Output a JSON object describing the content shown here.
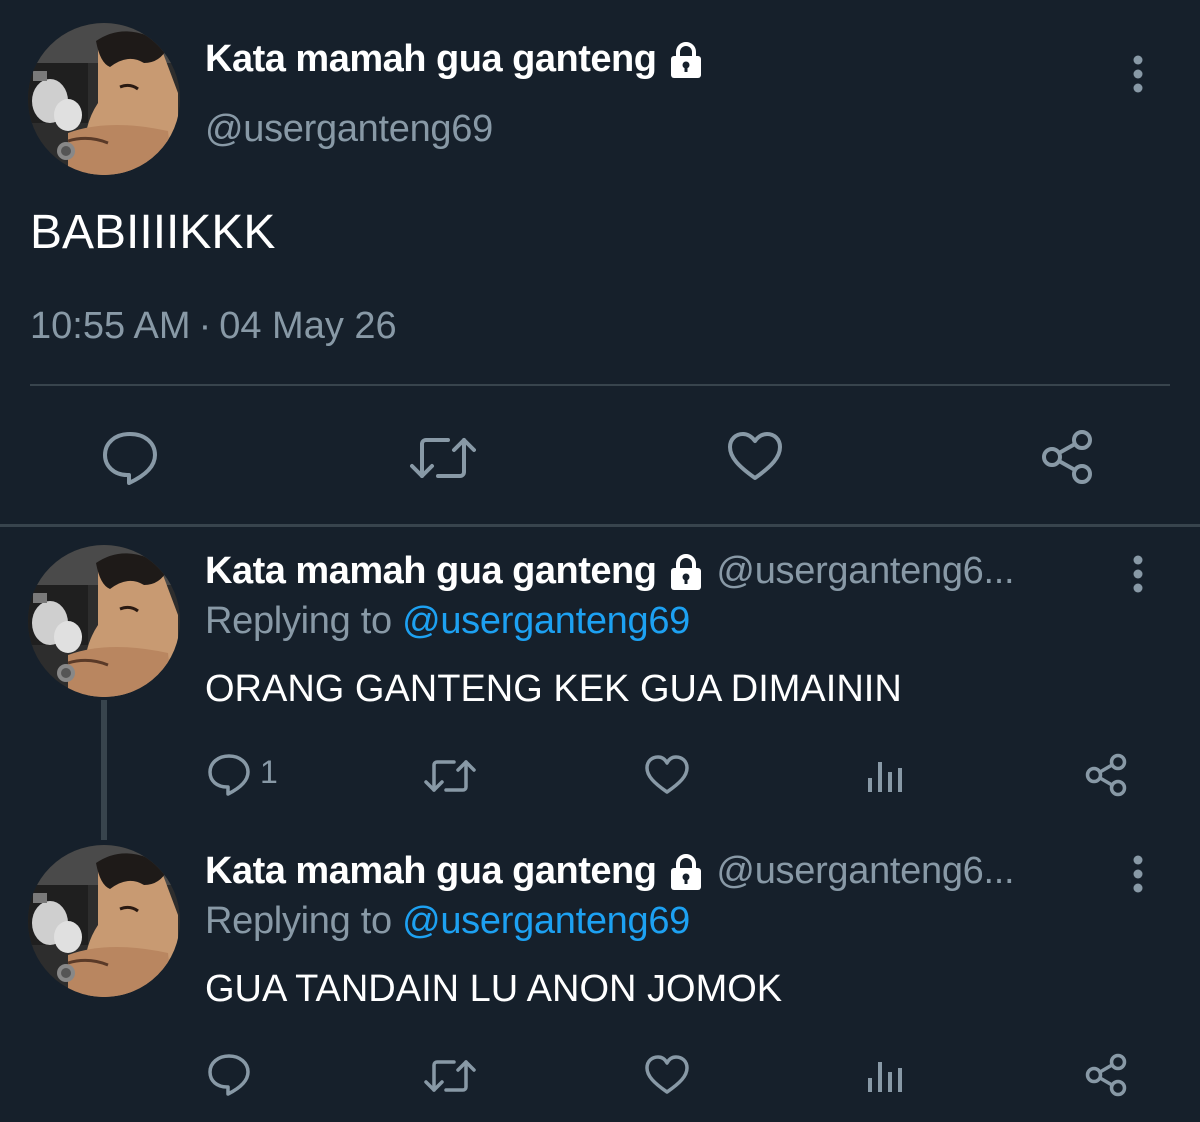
{
  "main_tweet": {
    "author_name": "Kata mamah gua ganteng",
    "handle": "@userganteng69",
    "text": "BABIIIIKKK",
    "time": "10:55 AM",
    "separator": "·",
    "date": "04 May 26",
    "icons": {
      "locked": "lock-icon",
      "more": "more-vertical-icon",
      "reply": "reply-icon",
      "retweet": "retweet-icon",
      "like": "heart-icon",
      "share": "share-icon"
    }
  },
  "replies": [
    {
      "author_name": "Kata mamah gua ganteng",
      "handle": "@userganteng6...",
      "replying_prefix": "Replying to",
      "replying_to": "@userganteng69",
      "text": "ORANG GANTENG KEK GUA DIMAININ",
      "reply_count": "1"
    },
    {
      "author_name": "Kata mamah gua ganteng",
      "handle": "@userganteng6...",
      "replying_prefix": "Replying to",
      "replying_to": "@userganteng69",
      "text": "GUA TANDAIN LU ANON JOMOK",
      "reply_count": ""
    }
  ],
  "colors": {
    "background": "#16202b",
    "secondary_text": "#8899a6",
    "mention": "#1da1f2",
    "divider": "#38444d"
  }
}
